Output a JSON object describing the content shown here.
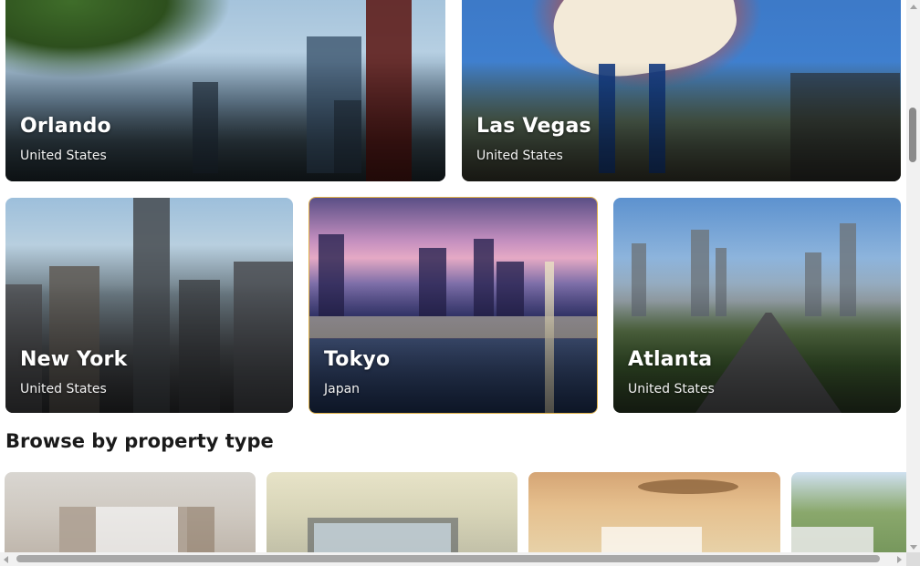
{
  "destinations": {
    "orlando": {
      "city": "Orlando",
      "country": "United States"
    },
    "las_vegas": {
      "city": "Las Vegas",
      "country": "United States"
    },
    "new_york": {
      "city": "New York",
      "country": "United States"
    },
    "tokyo": {
      "city": "Tokyo",
      "country": "Japan"
    },
    "atlanta": {
      "city": "Atlanta",
      "country": "United States"
    }
  },
  "property_section": {
    "title": "Browse by property type",
    "cards": [
      "room-photo",
      "apartment-photo",
      "villa-photo",
      "cabin-photo"
    ]
  },
  "colors": {
    "focus_border": "#e0b24a",
    "scrollbar_thumb": "#8b8b8b",
    "heading_text": "#1a1a1a"
  }
}
